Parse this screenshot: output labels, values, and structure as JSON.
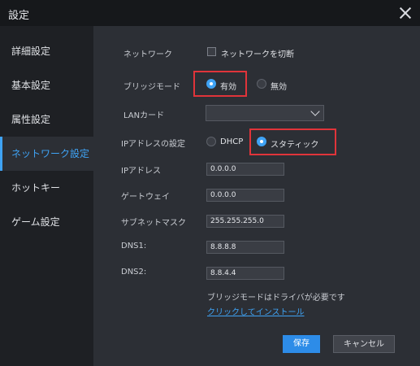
{
  "window": {
    "title": "設定"
  },
  "sidebar": {
    "items": [
      {
        "label": "詳細設定",
        "active": false
      },
      {
        "label": "基本設定",
        "active": false
      },
      {
        "label": "属性設定",
        "active": false
      },
      {
        "label": "ネットワーク設定",
        "active": true
      },
      {
        "label": "ホットキー",
        "active": false
      },
      {
        "label": "ゲーム設定",
        "active": false
      }
    ]
  },
  "network": {
    "network_label": "ネットワーク",
    "disconnect_checkbox_label": "ネットワークを切断",
    "disconnect_checked": false,
    "bridge_mode_label": "ブリッジモード",
    "bridge_enabled_label": "有効",
    "bridge_disabled_label": "無効",
    "bridge_mode_value": "有効",
    "lan_card_label": "LANカード",
    "lan_card_value": "",
    "ip_setting_label": "IPアドレスの設定",
    "dhcp_label": "DHCP",
    "static_label": "スタティック",
    "ip_mode_value": "スタティック",
    "ip_address_label": "IPアドレス",
    "ip_address_value": "0.0.0.0",
    "gateway_label": "ゲートウェイ",
    "gateway_value": "0.0.0.0",
    "subnet_label": "サブネットマスク",
    "subnet_value": "255.255.255.0",
    "dns1_label": "DNS1:",
    "dns1_value": "8.8.8.8",
    "dns2_label": "DNS2:",
    "dns2_value": "8.8.4.4",
    "driver_note": "ブリッジモードはドライバが必要です",
    "install_link": "クリックしてインストール"
  },
  "footer": {
    "save_label": "保存",
    "cancel_label": "キャンセル"
  },
  "colors": {
    "accent": "#3fa3f5",
    "highlight_border": "#e0343a",
    "primary_button": "#2d8ce8"
  },
  "icons": {
    "close": "close-icon",
    "dropdown": "chevron-down-icon"
  }
}
